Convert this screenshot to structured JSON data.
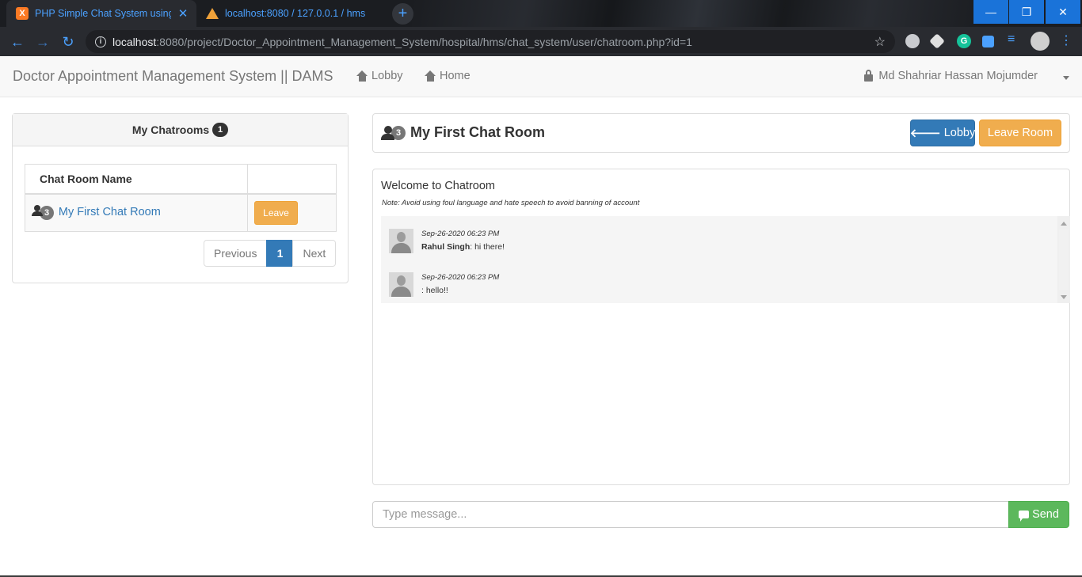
{
  "browser": {
    "tabs": [
      {
        "title": "PHP Simple Chat System using A",
        "favicon": "xampp-icon",
        "active": true
      },
      {
        "title": "localhost:8080 / 127.0.0.1 / hms",
        "favicon": "phpmyadmin-icon",
        "active": false
      }
    ],
    "url_host": "localhost",
    "url_rest": ":8080/project/Doctor_Appointment_Management_System/hospital/hms/chat_system/user/chatroom.php?id=1",
    "accent_color": "#4ba1ff"
  },
  "navbar": {
    "brand": "Doctor Appointment Management System || DAMS",
    "links": [
      {
        "label": "Lobby",
        "icon": "home-icon"
      },
      {
        "label": "Home",
        "icon": "home-icon"
      }
    ],
    "user_name": "Md Shahriar Hassan Mojumder"
  },
  "sidebar": {
    "title": "My Chatrooms",
    "count": "1",
    "table": {
      "header": "Chat Room Name",
      "rows": [
        {
          "members": "3",
          "name": "My First Chat Room",
          "action": "Leave"
        }
      ]
    },
    "pagination": {
      "previous": "Previous",
      "current": "1",
      "next": "Next"
    }
  },
  "room": {
    "members": "3",
    "name": "My First Chat Room",
    "lobby_button": "Lobby",
    "leave_button": "Leave Room",
    "welcome": "Welcome to Chatroom",
    "note": "Note: Avoid using foul language and hate speech to avoid banning of account",
    "messages": [
      {
        "time": "Sep-26-2020 06:23 PM",
        "sender": "Rahul Singh",
        "text": ": hi there!"
      },
      {
        "time": "Sep-26-2020 06:23 PM",
        "sender": "",
        "text": ": hello!!"
      }
    ]
  },
  "composer": {
    "placeholder": "Type message...",
    "send_label": "Send"
  },
  "colors": {
    "primary": "#337ab7",
    "warning": "#f0ad4e",
    "success": "#5cb85c"
  }
}
